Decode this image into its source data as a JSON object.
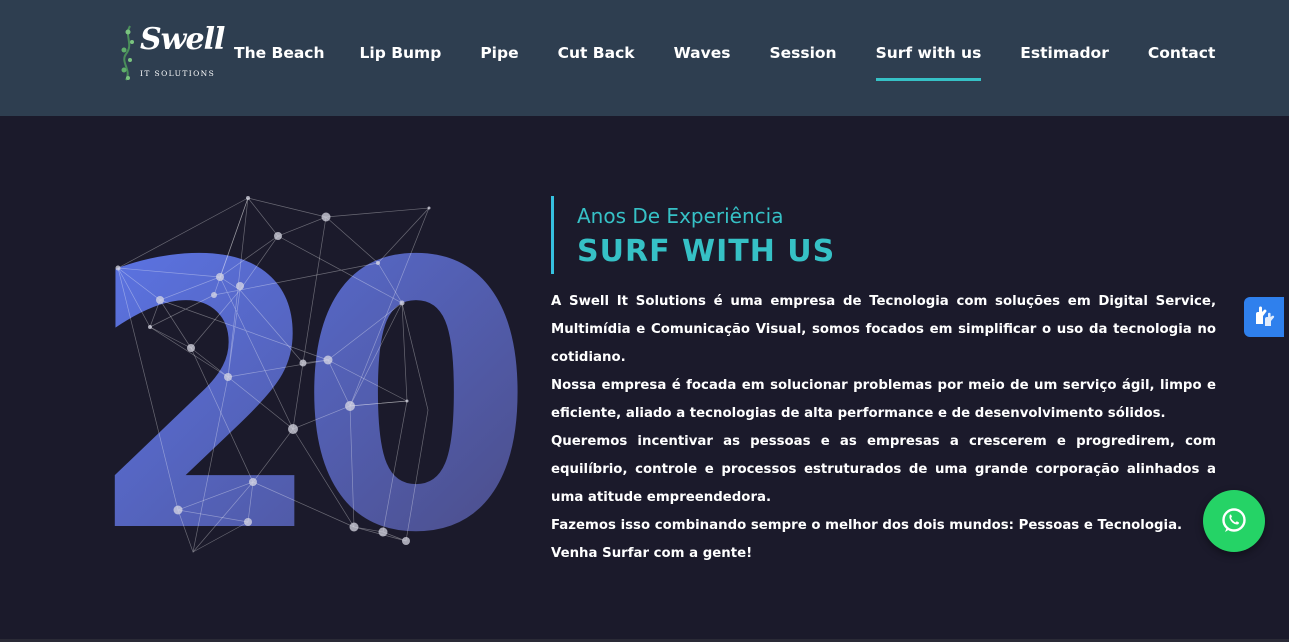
{
  "header": {
    "logo": {
      "name": "Swell",
      "subtitle": "IT SOLUTIONS"
    },
    "nav": [
      {
        "label": "The Beach",
        "active": false
      },
      {
        "label": "Lip Bump",
        "active": false
      },
      {
        "label": "Pipe",
        "active": false
      },
      {
        "label": "Cut Back",
        "active": false
      },
      {
        "label": "Waves",
        "active": false
      },
      {
        "label": "Session",
        "active": false
      },
      {
        "label": "Surf with us",
        "active": true
      },
      {
        "label": "Estimador",
        "active": false
      },
      {
        "label": "Contact",
        "active": false
      }
    ]
  },
  "main": {
    "big_number": "20",
    "subtitle": "Anos De Experiência",
    "title": "SURF WITH US",
    "paragraphs": [
      "A Swell It Solutions é uma empresa de Tecnologia com soluções em Digital Service, Multimídia e Comunicação Visual, somos focados em simplificar o uso da tecnologia no cotidiano.",
      "Nossa empresa é focada em solucionar problemas por meio de um serviço ágil, limpo e eficiente, aliado a tecnologias de alta performance e de desenvolvimento sólidos.",
      "Queremos incentivar as pessoas e as empresas a crescerem e progredirem, com equilíbrio, controle e processos estruturados de uma grande corporação alinhados a uma atitude empreendedora.",
      "Fazemos isso combinando sempre o melhor dos dois mundos: Pessoas e Tecnologia.",
      "Venha Surfar com a gente!"
    ]
  },
  "floating": {
    "accessibility_icon": "sign-language-hands-icon",
    "whatsapp_icon": "whatsapp-icon"
  },
  "colors": {
    "header_bg": "#2e3e50",
    "page_bg": "#1b1a2b",
    "accent": "#36c1c6",
    "number_gradient_start": "#5b73e8",
    "number_gradient_end": "#4f4f8a",
    "whatsapp_green": "#25d366",
    "a11y_blue": "#2f80ed"
  }
}
